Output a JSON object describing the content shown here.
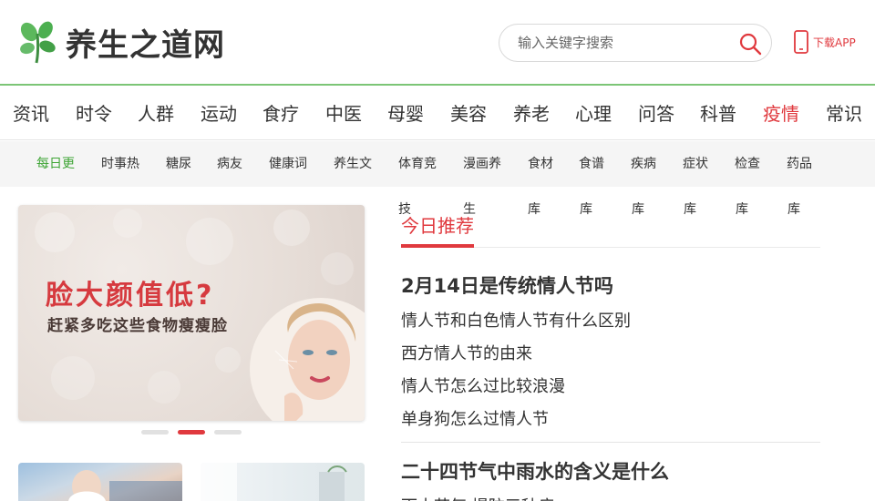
{
  "header": {
    "logo_text": "养生之道网",
    "search_placeholder": "输入关键字搜索",
    "download_label": "下载APP"
  },
  "main_nav": [
    {
      "label": "资讯"
    },
    {
      "label": "时令"
    },
    {
      "label": "人群"
    },
    {
      "label": "运动"
    },
    {
      "label": "食疗"
    },
    {
      "label": "中医"
    },
    {
      "label": "母婴"
    },
    {
      "label": "美容"
    },
    {
      "label": "养老"
    },
    {
      "label": "心理"
    },
    {
      "label": "问答"
    },
    {
      "label": "科普"
    },
    {
      "label": "疫情",
      "active": true
    },
    {
      "label": "常识"
    }
  ],
  "sub_nav": [
    {
      "label": "每日更",
      "active": true
    },
    {
      "label": "时事热"
    },
    {
      "label": "糖尿"
    },
    {
      "label": "病友"
    },
    {
      "label": "健康词"
    },
    {
      "label": "养生文"
    },
    {
      "label": "体育竞"
    },
    {
      "label": "漫画养"
    },
    {
      "label": "食材"
    },
    {
      "label": "食谱"
    },
    {
      "label": "疾病"
    },
    {
      "label": "症状"
    },
    {
      "label": "检查"
    },
    {
      "label": "药品"
    }
  ],
  "sub_nav_overflow": [
    "技",
    "生",
    "库",
    "库",
    "库",
    "库",
    "库",
    "库"
  ],
  "banner": {
    "title": "脸大颜值低?",
    "subtitle": "赶紧多吃这些食物瘦瘦脸",
    "active_slide": 2,
    "slide_count": 3
  },
  "today": {
    "tab_label": "今日推荐",
    "groups": [
      {
        "title": "2月14日是传统情人节吗",
        "links": [
          "情人节和白色情人节有什么区别",
          "西方情人节的由来",
          "情人节怎么过比较浪漫",
          "单身狗怎么过情人节"
        ]
      },
      {
        "title": "二十四节气中雨水的含义是什么",
        "links": [
          "雨水节气 提防三种病"
        ]
      }
    ]
  },
  "colors": {
    "accent_red": "#e0393e",
    "accent_green": "#3fa536",
    "header_border": "#7cc576"
  }
}
